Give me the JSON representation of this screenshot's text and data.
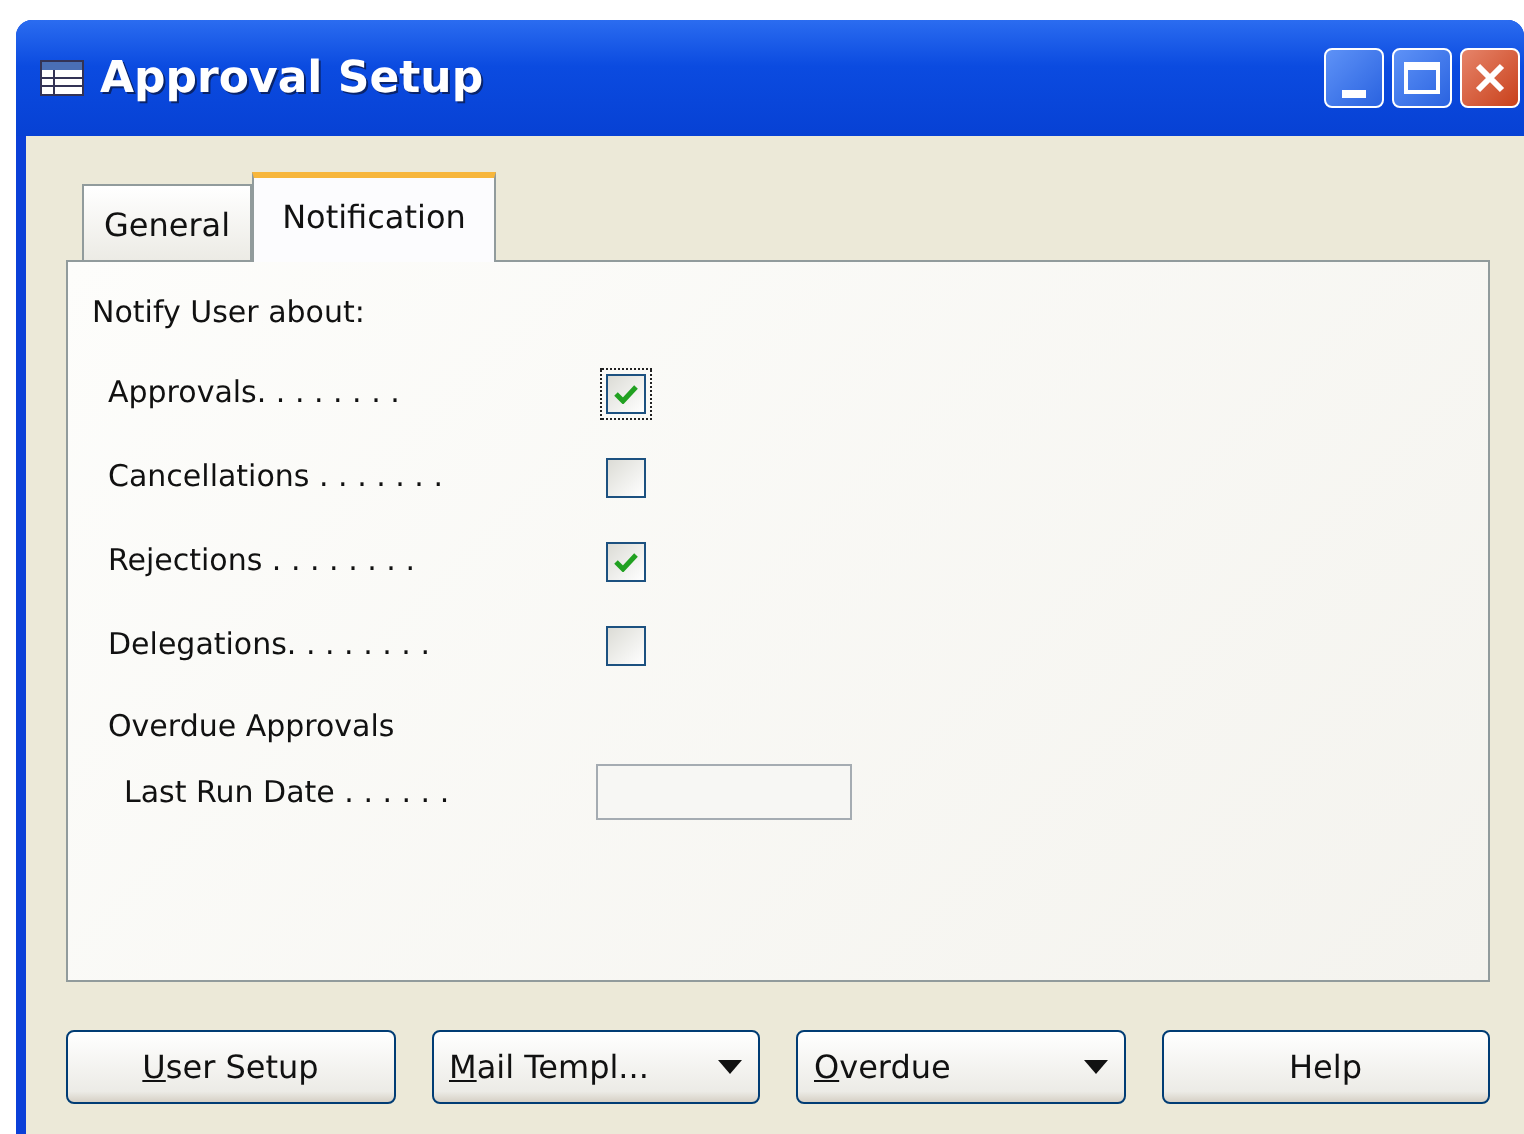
{
  "window": {
    "title": "Approval Setup"
  },
  "tabs": [
    {
      "label": "General",
      "selected": false
    },
    {
      "label": "Notification",
      "selected": true
    }
  ],
  "section_heading": "Notify User about:",
  "options": [
    {
      "label": "Approvals. . . . . . . .",
      "checked": true,
      "focused": true
    },
    {
      "label": "Cancellations . . . . . . .",
      "checked": false,
      "focused": false
    },
    {
      "label": "Rejections . . . . . . . .",
      "checked": true,
      "focused": false
    },
    {
      "label": "Delegations. . . . . . . .",
      "checked": false,
      "focused": false
    }
  ],
  "overdue_heading": "Overdue Approvals",
  "last_run_date": {
    "label": "Last Run Date . . . . . ."
  },
  "buttons": [
    {
      "access_key": "U",
      "label_rest": "ser Setup",
      "dropdown": false
    },
    {
      "access_key": "M",
      "label_rest": "ail Templ...",
      "dropdown": true
    },
    {
      "access_key": "O",
      "label_rest": "verdue",
      "dropdown": true
    },
    {
      "label_rest": "Help",
      "dropdown": false
    }
  ]
}
